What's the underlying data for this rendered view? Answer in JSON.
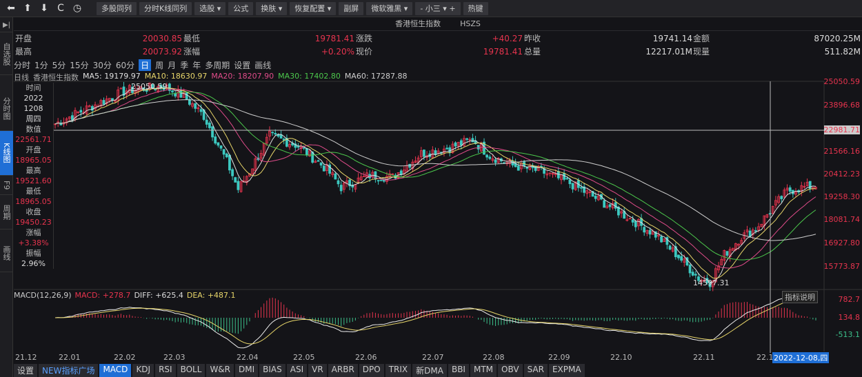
{
  "toolbar": {
    "icons": [
      "arrow-left-icon",
      "arrow-up-icon",
      "arrow-down-icon",
      "refresh-icon",
      "clock-icon"
    ],
    "buttons": [
      "多股同列",
      "分时K线同列",
      "选股 ▾",
      "公式",
      "换肤 ▾",
      "恢复配置 ▾",
      "副屏",
      "微软雅黑 ▾",
      "- 小三 ▾ +",
      "热键"
    ]
  },
  "sidebar": {
    "toggle": "▶|",
    "items": [
      "自选股",
      "分时图",
      "K线图",
      "F9",
      "周期",
      "画线"
    ],
    "active": 2
  },
  "title": {
    "name": "香港恒生指数",
    "code": "HSZS"
  },
  "quote": {
    "open_label": "开盘",
    "open": "20030.85",
    "low_label": "最低",
    "low": "19781.41",
    "chg_label": "涨跌",
    "chg": "+40.27",
    "prev_label": "昨收",
    "prev": "19741.14",
    "amt_label": "金额",
    "amt": "87020.25M",
    "high_label": "最高",
    "high": "20073.92",
    "pct_label": "涨幅",
    "pct": "+0.20%",
    "last_label": "现价",
    "last": "19781.41",
    "vol_label": "总量",
    "vol": "12217.01M",
    "cur_label": "现量",
    "cur": "511.82M"
  },
  "periods": [
    "分时",
    "1分",
    "5分",
    "15分",
    "30分",
    "60分",
    "日",
    "周",
    "月",
    "季",
    "年",
    "多周期",
    "设置",
    "画线"
  ],
  "period_active": 6,
  "ma_legend": {
    "prefix": "日线",
    "name": "香港恒生指数",
    "items": [
      {
        "text": "MA5: 19179.97",
        "color": "#e0e0e0"
      },
      {
        "text": "MA10: 18630.97",
        "color": "#e8d66a"
      },
      {
        "text": "MA20: 18207.90",
        "color": "#e04c8a"
      },
      {
        "text": "MA30: 17402.80",
        "color": "#4cc84c"
      },
      {
        "text": "MA60: 17287.88",
        "color": "#cfcfcf"
      }
    ]
  },
  "info_panel": [
    [
      "时间",
      "lab"
    ],
    [
      "2022",
      "wht"
    ],
    [
      "1208",
      "wht"
    ],
    [
      "周四",
      "wht"
    ],
    [
      "数值",
      "lab"
    ],
    [
      "22561.71",
      "red"
    ],
    [
      "开盘",
      "lab"
    ],
    [
      "18965.05",
      "red"
    ],
    [
      "最高",
      "lab"
    ],
    [
      "19521.60",
      "red"
    ],
    [
      "最低",
      "lab"
    ],
    [
      "18965.05",
      "red"
    ],
    [
      "收盘",
      "lab"
    ],
    [
      "19450.23",
      "red"
    ],
    [
      "涨幅",
      "lab"
    ],
    [
      "+3.38%",
      "red"
    ],
    [
      "振幅",
      "lab"
    ],
    [
      "2.96%",
      "wht"
    ]
  ],
  "price_axis": [
    "25050.59",
    "23896.68",
    "22981.71",
    "21566.16",
    "20412.23",
    "19258.30",
    "18081.74",
    "16927.80",
    "15773.87"
  ],
  "annotations": {
    "high": "25050.59",
    "low": "14597.31",
    "crosshair_date": "2022-12-08,四",
    "indicator_help": "指标说明"
  },
  "macd": {
    "legend": "MACD(12,26,9)",
    "macd": "MACD: +278.7",
    "diff": "DIFF: +625.4",
    "dea": "DEA: +487.1",
    "axis": [
      "782.7",
      "134.8",
      "-513.1"
    ]
  },
  "x_axis": [
    "21.12",
    "22.01",
    "22.02",
    "22.03",
    "22.04",
    "22.05",
    "22.06",
    "22.07",
    "22.08",
    "22.09",
    "22.10",
    "22.11",
    "22.1"
  ],
  "indicator_tabs": [
    "设置",
    "NEW指标广场",
    "MACD",
    "KDJ",
    "RSI",
    "BOLL",
    "W&R",
    "DMI",
    "BIAS",
    "ASI",
    "VR",
    "ARBR",
    "DPO",
    "TRIX",
    "新DMA",
    "BBI",
    "MTM",
    "OBV",
    "SAR",
    "EXPMA"
  ],
  "indicator_active": 2,
  "chart_data": {
    "type": "candlestick",
    "ylim": [
      14597.31,
      25050.59
    ],
    "anchors": [
      [
        0,
        22900
      ],
      [
        10,
        23600
      ],
      [
        25,
        24600
      ],
      [
        38,
        24800
      ],
      [
        45,
        24300
      ],
      [
        52,
        23300
      ],
      [
        60,
        21000
      ],
      [
        64,
        19600
      ],
      [
        68,
        20500
      ],
      [
        75,
        22300
      ],
      [
        85,
        21800
      ],
      [
        95,
        20600
      ],
      [
        100,
        19700
      ],
      [
        110,
        20300
      ],
      [
        118,
        20200
      ],
      [
        128,
        21400
      ],
      [
        138,
        21700
      ],
      [
        146,
        22100
      ],
      [
        152,
        21300
      ],
      [
        160,
        20800
      ],
      [
        170,
        20500
      ],
      [
        180,
        19900
      ],
      [
        192,
        18900
      ],
      [
        200,
        18200
      ],
      [
        210,
        17300
      ],
      [
        218,
        16200
      ],
      [
        225,
        15100
      ],
      [
        229,
        14900
      ],
      [
        234,
        16300
      ],
      [
        240,
        17200
      ],
      [
        245,
        17600
      ],
      [
        250,
        18500
      ],
      [
        256,
        19500
      ],
      [
        262,
        19700
      ],
      [
        266,
        19781
      ]
    ]
  }
}
